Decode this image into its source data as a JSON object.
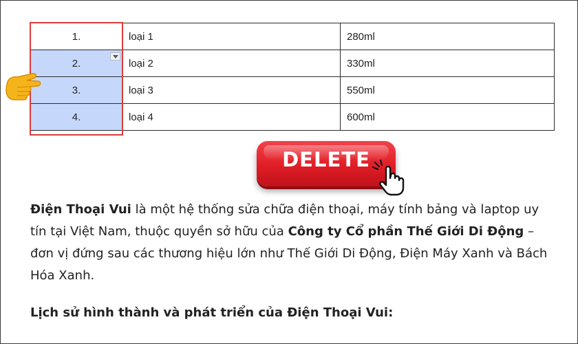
{
  "table": {
    "rows": [
      {
        "num": "1.",
        "name": "loại 1",
        "volume": "280ml"
      },
      {
        "num": "2.",
        "name": "loại 2",
        "volume": "330ml"
      },
      {
        "num": "3.",
        "name": "loại 3",
        "volume": "550ml"
      },
      {
        "num": "4.",
        "name": "loại 4",
        "volume": "600ml"
      }
    ]
  },
  "delete_button": {
    "label": "DELETE"
  },
  "article": {
    "p1": {
      "brand": "Điện Thoại Vui",
      "part1": " là một hệ thống sửa chữa điện thoại, máy tính bảng và laptop uy tín tại Việt Nam, thuộc quyền sở hữu của ",
      "company": "Công ty Cổ phần Thế Giới Di Động",
      "part2": " – đơn vị đứng sau các thương hiệu lớn như Thế Giới Di Động, Điện Máy Xanh và Bách Hóa Xanh."
    },
    "heading": "Lịch sử hình thành và phát triển của Điện Thoại Vui:"
  },
  "colors": {
    "selection": "#c5d8fb",
    "outline": "#d93b3b",
    "delete": "#e01d26"
  }
}
